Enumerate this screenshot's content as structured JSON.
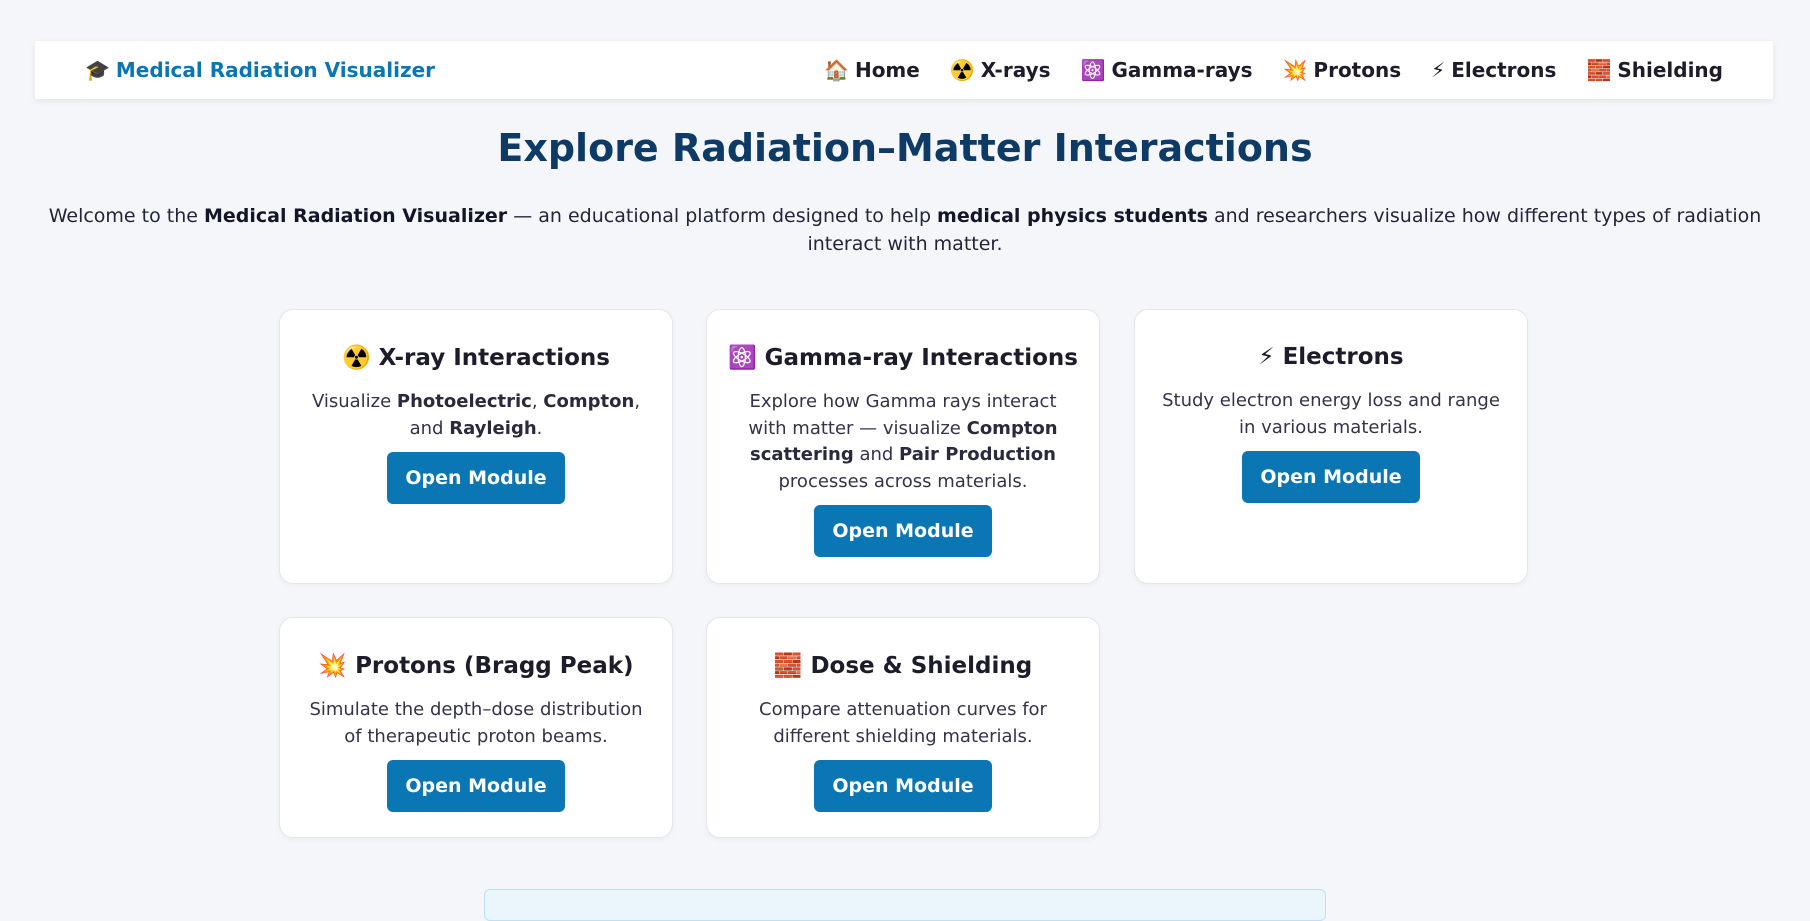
{
  "brand": {
    "icon": "graduation-cap-icon",
    "icon_glyph": "🎓",
    "label": "Medical Radiation Visualizer"
  },
  "nav": [
    {
      "icon": "home-icon",
      "glyph": "🏠",
      "label": "Home"
    },
    {
      "icon": "radioactive-icon",
      "glyph": "☢️",
      "label": "X-rays"
    },
    {
      "icon": "atom-icon",
      "glyph": "⚛️",
      "label": "Gamma-rays"
    },
    {
      "icon": "collision-icon",
      "glyph": "💥",
      "label": "Protons"
    },
    {
      "icon": "lightning-icon",
      "glyph": "⚡",
      "label": "Electrons"
    },
    {
      "icon": "brick-icon",
      "glyph": "🧱",
      "label": "Shielding"
    }
  ],
  "page_title": "Explore Radiation–Matter Interactions",
  "intro": {
    "p1": "Welcome to the ",
    "b1": "Medical Radiation Visualizer",
    "p2": " — an educational platform designed to help ",
    "b2": "medical physics students",
    "p3": " and researchers visualize how different types of radiation interact with matter."
  },
  "cards": [
    {
      "icon": "radioactive-icon",
      "glyph": "☢️",
      "title": "X-ray Interactions",
      "desc": {
        "t1": "Visualize ",
        "b1": "Photoelectric",
        "t2": ", ",
        "b2": "Compton",
        "t3": ", and ",
        "b3": "Rayleigh",
        "t4": "."
      },
      "button": "Open Module"
    },
    {
      "icon": "atom-icon",
      "glyph": "⚛️",
      "title": "Gamma-ray Interactions",
      "desc": {
        "t1": "Explore how Gamma rays interact with matter — visualize ",
        "b1": "Compton scattering",
        "t2": " and ",
        "b2": "Pair Production",
        "t3": " processes across materials."
      },
      "button": "Open Module"
    },
    {
      "icon": "lightning-icon",
      "glyph": "⚡",
      "title": "Electrons",
      "desc": {
        "t1": "Study electron energy loss and range in various materials."
      },
      "button": "Open Module"
    },
    {
      "icon": "collision-icon",
      "glyph": "💥",
      "title": "Protons (Bragg Peak)",
      "desc": {
        "t1": "Simulate the depth–dose distribution of therapeutic proton beams."
      },
      "button": "Open Module"
    },
    {
      "icon": "brick-icon",
      "glyph": "🧱",
      "title": "Dose & Shielding",
      "desc": {
        "t1": "Compare attenuation curves for different shielding materials."
      },
      "button": "Open Module"
    }
  ]
}
